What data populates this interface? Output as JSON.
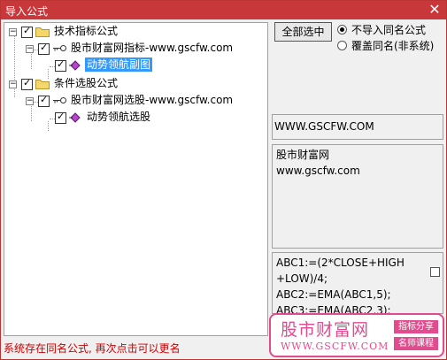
{
  "window": {
    "title": "导入公式",
    "close_glyph": "✕"
  },
  "tree": {
    "groups": [
      {
        "label": "技术指标公式",
        "expander": "−",
        "children": [
          {
            "label": "股市财富网指标-www.gscfw.com",
            "expander": "−",
            "items": [
              {
                "label": "动势领航副图",
                "selected": true
              }
            ]
          }
        ]
      },
      {
        "label": "条件选股公式",
        "expander": "−",
        "children": [
          {
            "label": "股市财富网选股-www.gscfw.com",
            "expander": "−",
            "items": [
              {
                "label": "动势领航选股",
                "selected": false
              }
            ]
          }
        ]
      }
    ]
  },
  "options": {
    "select_all_label": "全部选中",
    "radio_1": "不导入同名公式",
    "radio_2": "覆盖同名(非系统)",
    "radio_selected": 1
  },
  "info": {
    "source": "WWW.GSCFW.COM",
    "description": "股市财富网\nwww.gscfw.com",
    "code": "ABC1:=(2*CLOSE+HIGH\n+LOW)/4;\nABC2:=EMA(ABC1,5);\nABC3:=EMA(ABC2,3);"
  },
  "status": "系统存在同名公式, 再次点击可以更名",
  "watermark": {
    "name": "股市财富网",
    "url": "WWW.GSCFW.COM",
    "tag_1": "指标分享",
    "tag_2": "名师课程",
    "color": "#e24b8d"
  },
  "colors": {
    "titlebar": "#c8373a",
    "selection": "#3399ff",
    "status": "#cc0000"
  }
}
